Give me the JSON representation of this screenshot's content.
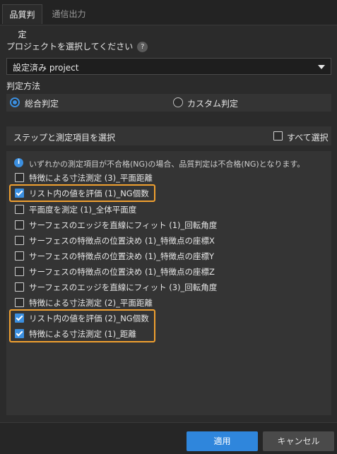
{
  "tabs": [
    {
      "label": "品質判定",
      "active": true
    },
    {
      "label": "通信出力",
      "active": false
    }
  ],
  "project": {
    "label": "プロジェクトを選択してください",
    "help_icon": "?",
    "selected": "設定済み project"
  },
  "method": {
    "label": "判定方法",
    "options": [
      {
        "label": "総合判定",
        "selected": true
      },
      {
        "label": "カスタム判定",
        "selected": false
      }
    ]
  },
  "steps": {
    "header": "ステップと測定項目を選択",
    "select_all": "すべて選択",
    "info": "いずれかの測定項目が不合格(NG)の場合、品質判定は不合格(NG)となります。",
    "items": [
      {
        "label": "特徴による寸法測定 (3)_平面距離",
        "checked": false
      },
      {
        "label": "リスト内の値を評価 (1)_NG個数",
        "checked": true
      },
      {
        "label": "平面度を測定 (1)_全体平面度",
        "checked": false
      },
      {
        "label": "サーフェスのエッジを直線にフィット (1)_回転角度",
        "checked": false
      },
      {
        "label": "サーフェスの特徴点の位置決め (1)_特徴点の座標X",
        "checked": false
      },
      {
        "label": "サーフェスの特徴点の位置決め (1)_特徴点の座標Y",
        "checked": false
      },
      {
        "label": "サーフェスの特徴点の位置決め (1)_特徴点の座標Z",
        "checked": false
      },
      {
        "label": "サーフェスのエッジを直線にフィット (3)_回転角度",
        "checked": false
      },
      {
        "label": "特徴による寸法測定 (2)_平面距離",
        "checked": false
      },
      {
        "label": "リスト内の値を評価 (2)_NG個数",
        "checked": true
      },
      {
        "label": "特徴による寸法測定 (1)_距離",
        "checked": true
      }
    ]
  },
  "footer": {
    "apply": "適用",
    "cancel": "キャンセル"
  },
  "colors": {
    "accent": "#3b8fe0",
    "highlight": "#f0a030",
    "background": "#2b2b2b"
  }
}
